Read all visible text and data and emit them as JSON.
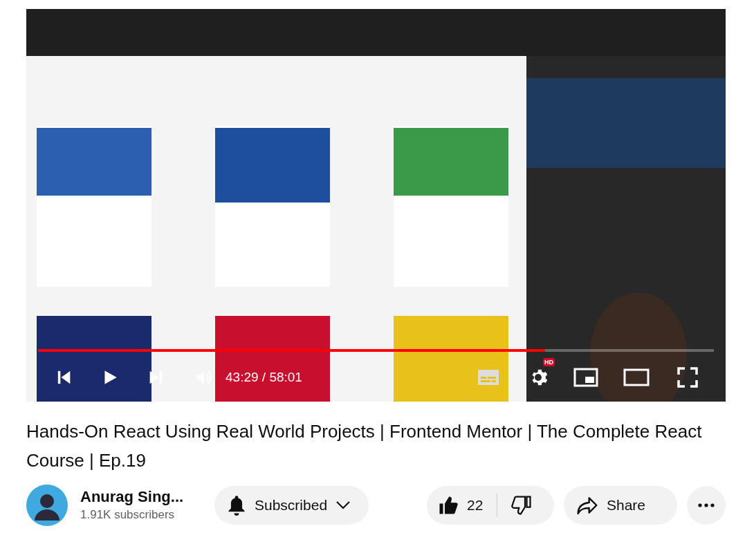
{
  "video": {
    "progress": {
      "level": 0.75
    },
    "time": "43:29 / 58:01",
    "quality_badge": "HD"
  },
  "title": "Hands-On React Using Real World Projects | Frontend Mentor | The Complete React Course | Ep.19",
  "channel": {
    "name": "Anurag Sing...",
    "subscribers": "1.91K subscribers"
  },
  "subscribe_button": {
    "label": "Subscribed"
  },
  "likes": "22",
  "share_button": {
    "label": "Share"
  }
}
